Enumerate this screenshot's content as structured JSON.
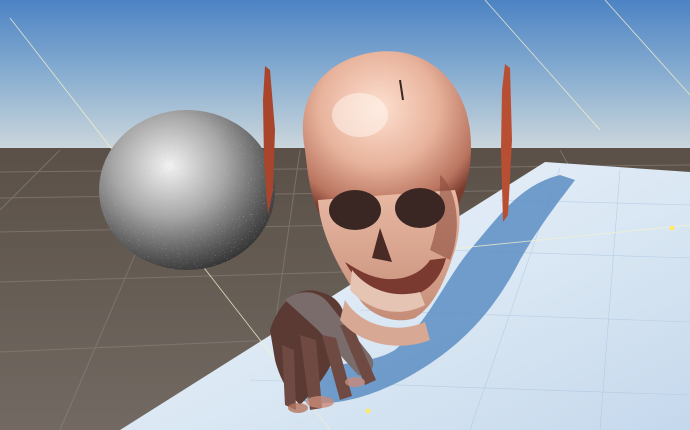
{
  "viewport": {
    "mode": "scene-view",
    "projection": "perspective"
  },
  "scene": {
    "objects": [
      {
        "name": "volume-skull",
        "kind": "volume-rendered-skull",
        "icon": "skull-icon"
      },
      {
        "name": "volume-hand",
        "kind": "volume-rendered-hand-bones",
        "icon": "bone-icon"
      },
      {
        "name": "noise-sphere",
        "kind": "sphere",
        "icon": "sphere-icon"
      },
      {
        "name": "floor-plane",
        "kind": "plane",
        "icon": "plane-icon"
      },
      {
        "name": "slice-plane-left",
        "kind": "cross-section-plane",
        "icon": "slice-icon"
      },
      {
        "name": "slice-plane-right",
        "kind": "cross-section-plane",
        "icon": "slice-icon"
      }
    ]
  },
  "colors": {
    "sky_top": "#4f86c6",
    "sky_horizon": "#c9d6df",
    "ground": "#6d655d",
    "grid_line": "#8e8880",
    "plane_light": "#dce9f6",
    "plane_shadow": "#5f8fc4",
    "skull_bone": "#e8b8a4",
    "skull_shadow": "#8a4a3a",
    "slice_red": "#b0492e",
    "sphere_light": "#d8d8d8",
    "sphere_dark": "#3c3c3c",
    "light_ray": "#f5f0c8"
  }
}
